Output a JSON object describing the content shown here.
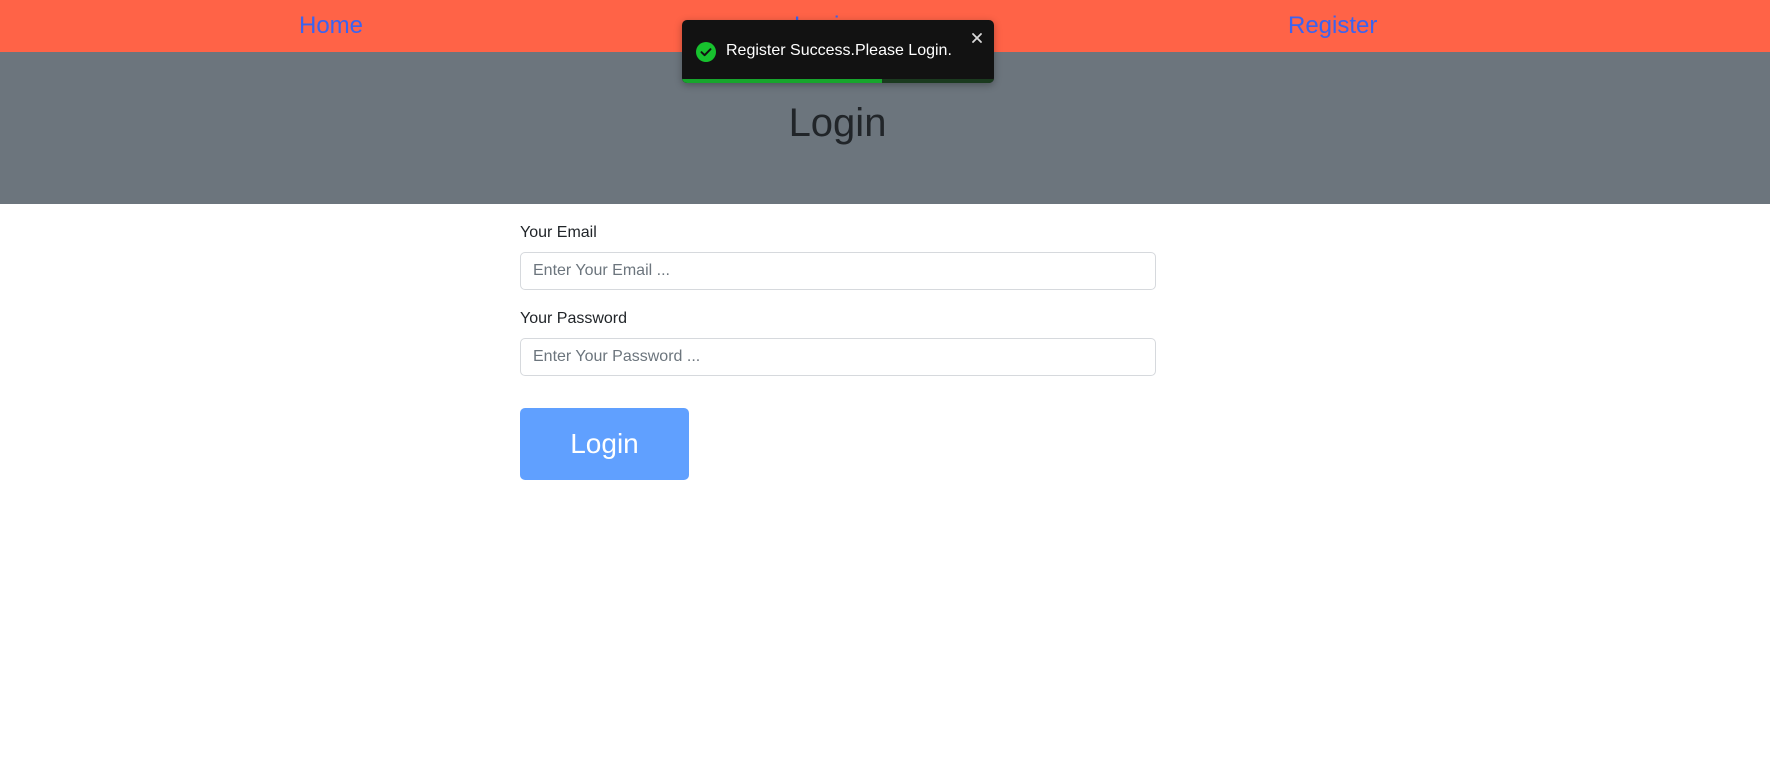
{
  "nav": {
    "home_label": "Home",
    "login_label": "Login",
    "register_label": "Register"
  },
  "banner": {
    "title": "Login"
  },
  "form": {
    "email_label": "Your Email",
    "email_placeholder": "Enter Your Email ...",
    "email_value": "",
    "password_label": "Your Password",
    "password_placeholder": "Enter Your Password ...",
    "password_value": "",
    "submit_label": "Login"
  },
  "toast": {
    "message": "Register Success.Please Login.",
    "icon": "check-circle-icon",
    "close_icon": "close-icon",
    "progress_fraction": 0.64
  },
  "colors": {
    "nav_background": "#ff6347",
    "nav_link": "#3b63f0",
    "banner_background": "#6c757d",
    "button_background": "#60a0ff",
    "toast_background": "#121212",
    "toast_success": "#17c22e"
  }
}
